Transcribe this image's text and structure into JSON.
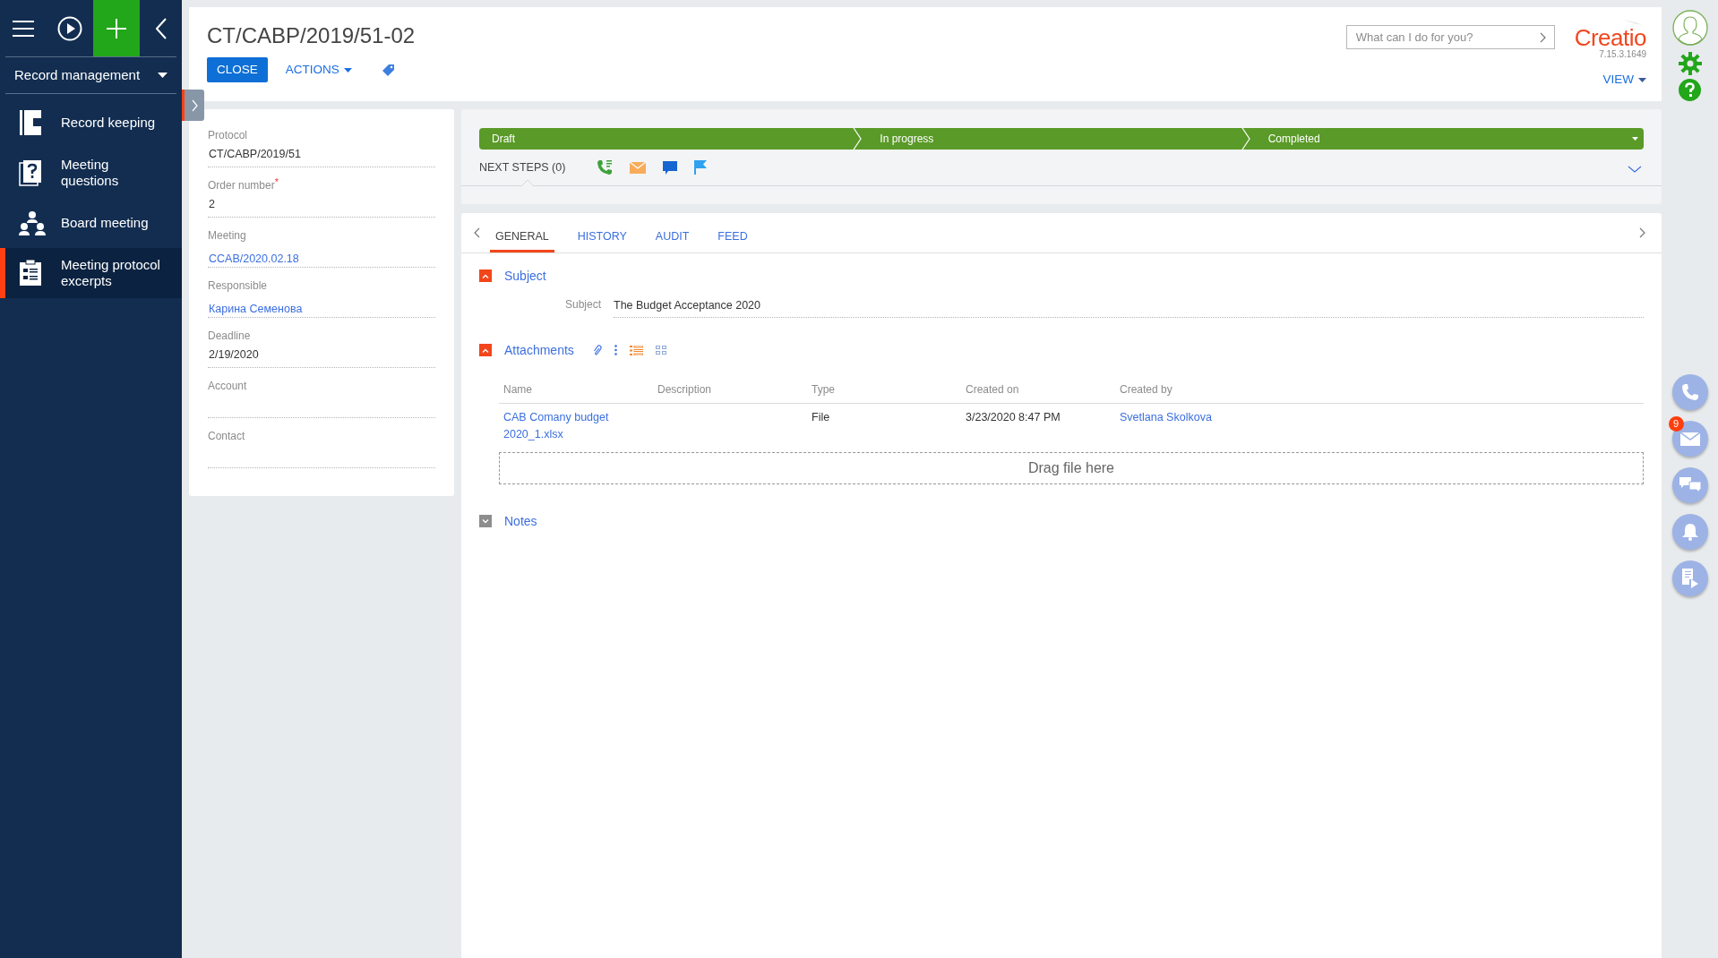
{
  "sidebar": {
    "workplace": "Record management",
    "items": [
      {
        "label": "Record keeping",
        "kind": "book",
        "selected": false
      },
      {
        "label": "Meeting questions",
        "kind": "question",
        "selected": false
      },
      {
        "label": "Board meeting",
        "kind": "people",
        "selected": false
      },
      {
        "label": "Meeting protocol excerpts",
        "kind": "clipboard",
        "selected": true
      }
    ]
  },
  "header": {
    "title": "CT/CABP/2019/51-02",
    "buttons": [
      {
        "label": "CLOSE",
        "kind": "primary"
      },
      {
        "label": "ACTIONS",
        "kind": "menu"
      }
    ],
    "search": {
      "placeholder": "What can I do for you?"
    },
    "logo": "Creatio",
    "version": "7.15.3.1649",
    "view": "VIEW"
  },
  "fields": [
    {
      "label": "Protocol",
      "value": "CT/CABP/2019/51",
      "kind": "text"
    },
    {
      "label": "Order number",
      "required_mark": "*",
      "value": "2",
      "kind": "text"
    },
    {
      "label": "Meeting",
      "value": "CCAB/2020.02.18",
      "kind": "link"
    },
    {
      "label": "Responsible",
      "value": "Карина Семенова",
      "kind": "link"
    },
    {
      "label": "Deadline",
      "value": "2/19/2020",
      "kind": "text"
    },
    {
      "label": "Account",
      "kind": "empty"
    },
    {
      "label": "Contact",
      "kind": "empty"
    }
  ],
  "stages": [
    {
      "label": "Draft"
    },
    {
      "label": "In progress"
    },
    {
      "label": "Completed"
    }
  ],
  "next_steps": "NEXT STEPS (0)",
  "tabs": [
    {
      "label": "GENERAL",
      "selected": true
    },
    {
      "label": "HISTORY",
      "selected": false
    },
    {
      "label": "AUDIT",
      "selected": false
    },
    {
      "label": "FEED",
      "selected": false
    }
  ],
  "sections": [
    {
      "kind": "field",
      "title": "Subject",
      "expanded": true,
      "field": {
        "label": "Subject",
        "value": "The Budget Acceptance 2020"
      }
    },
    {
      "kind": "attachments",
      "title": "Attachments",
      "expanded": true,
      "columns": [
        "Name",
        "Description",
        "Type",
        "Created on",
        "Created by"
      ],
      "rows": [
        {
          "name": "CAB Comany budget 2020_1.xlsx",
          "type": "File",
          "created_on": "3/23/2020 8:47 PM",
          "created_by": "Svetlana Skolkova"
        }
      ],
      "dropzone": "Drag file here"
    },
    {
      "kind": "notes",
      "title": "Notes",
      "expanded": false
    }
  ],
  "communications": [
    {
      "kind": "phone"
    },
    {
      "kind": "email",
      "badge": "9"
    },
    {
      "kind": "chat"
    },
    {
      "kind": "bell"
    },
    {
      "kind": "feed"
    }
  ]
}
